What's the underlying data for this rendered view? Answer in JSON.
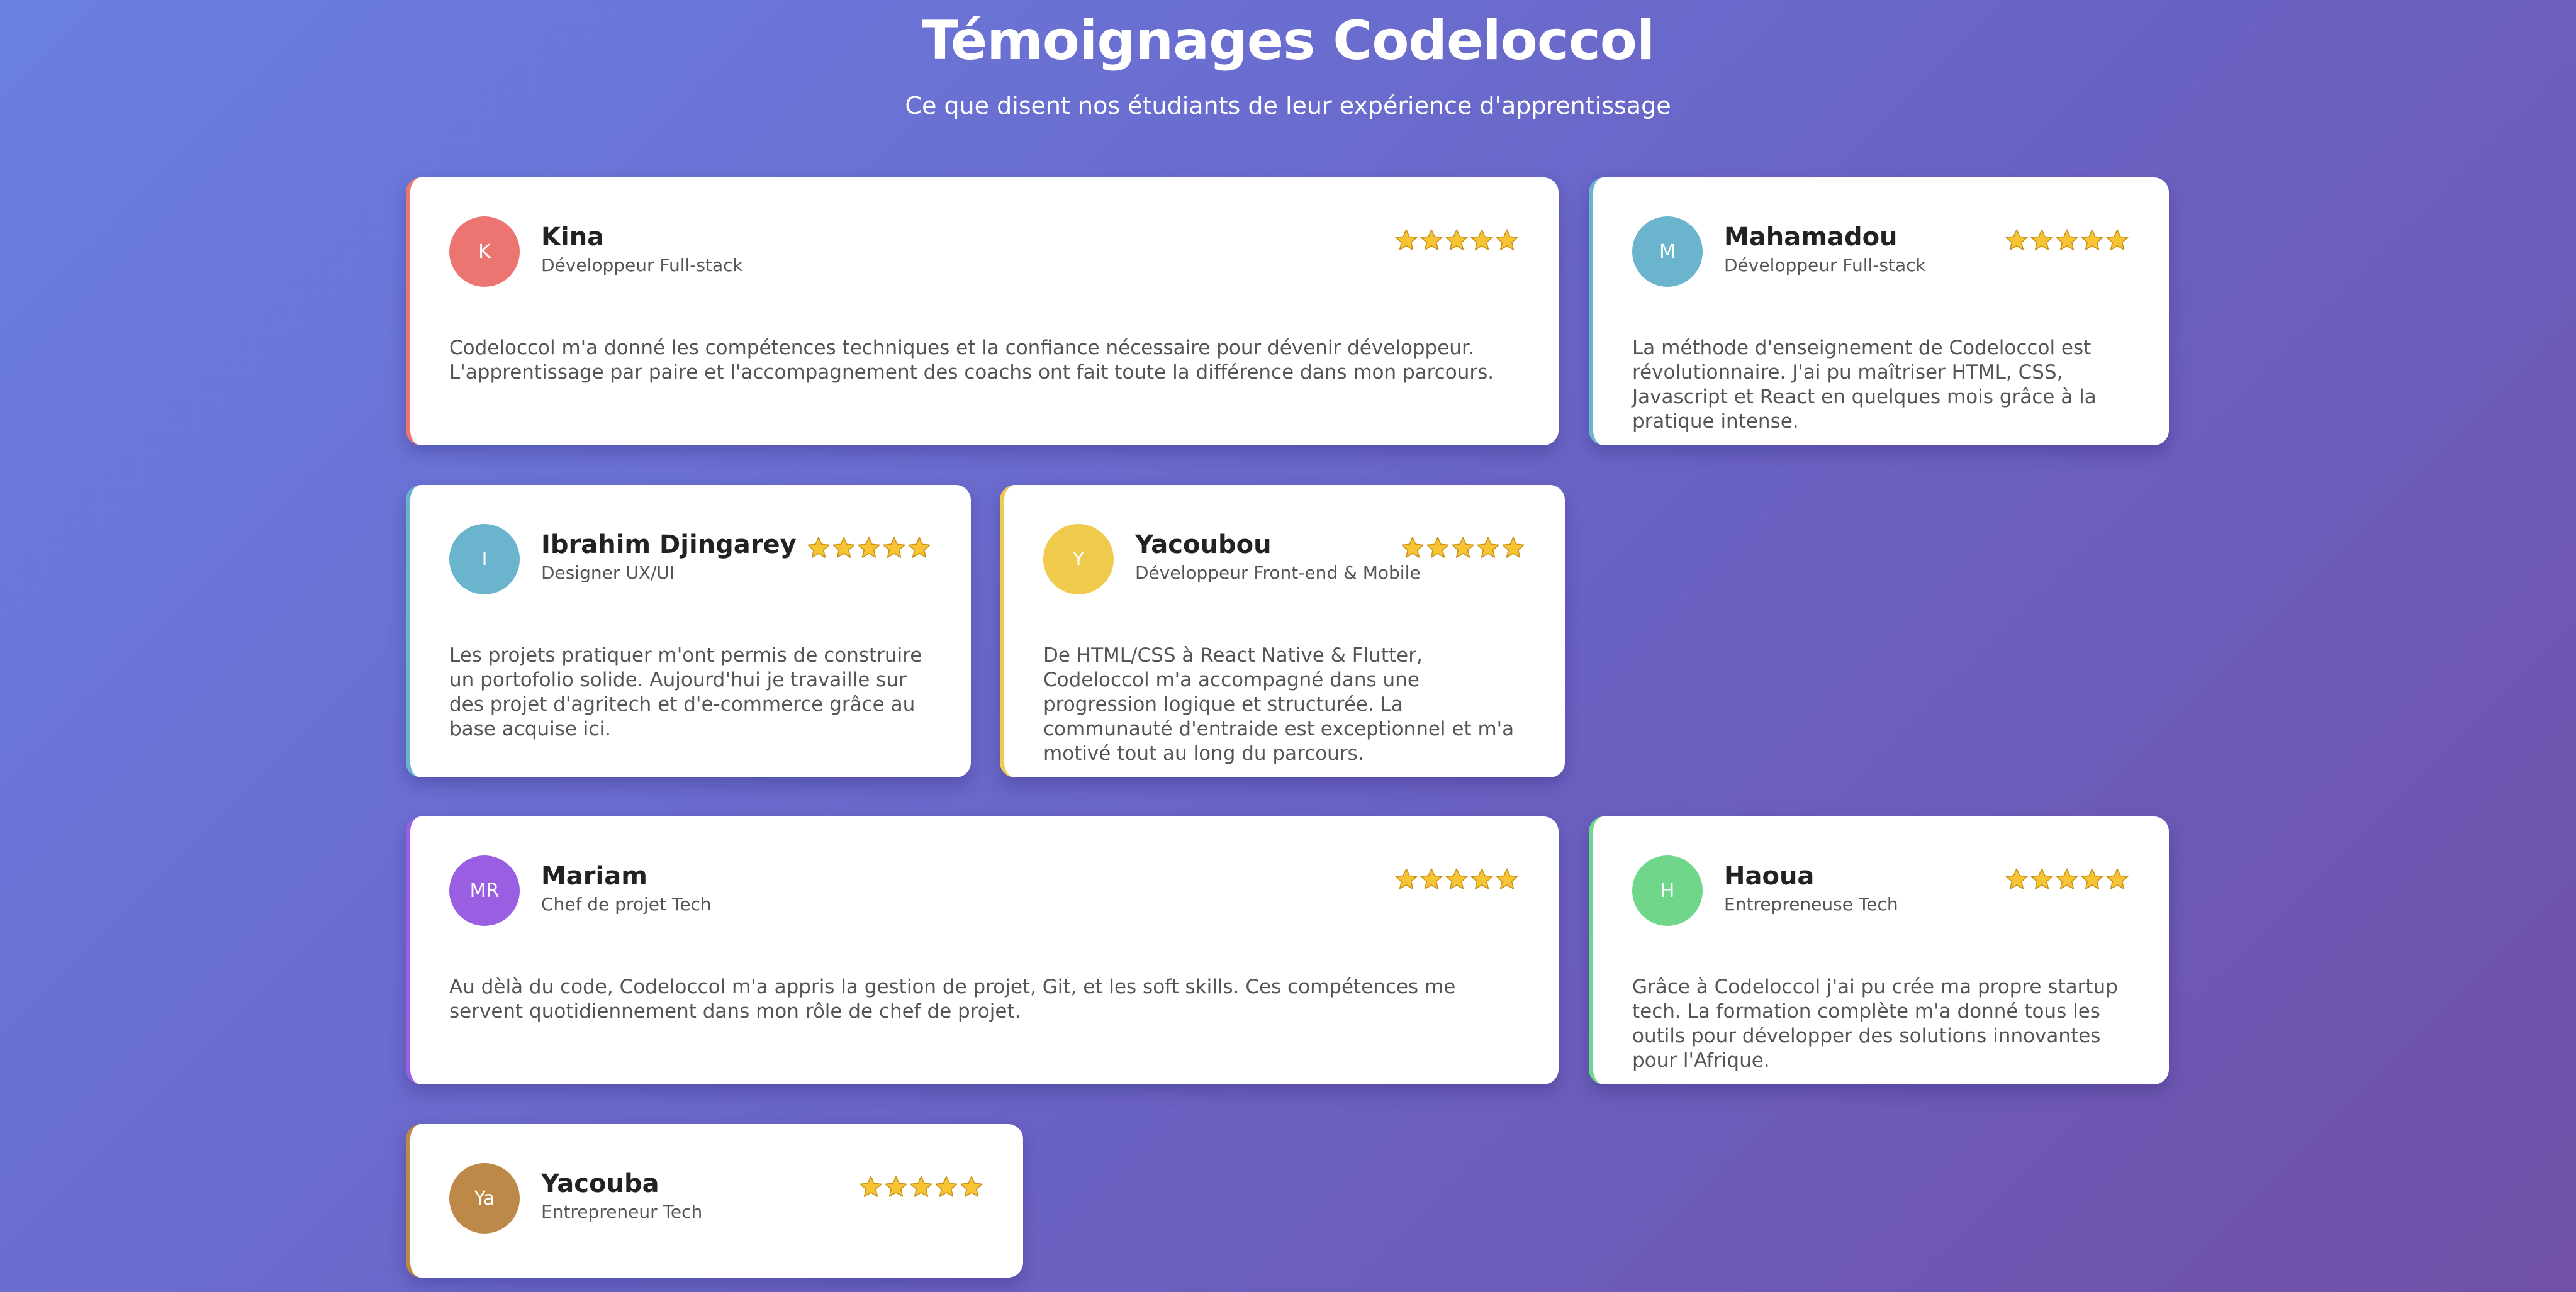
{
  "header": {
    "title": "Témoignages Codeloccol",
    "subtitle": "Ce que disent nos étudiants de leur expérience d'apprentissage"
  },
  "testimonials": [
    {
      "initials": "K",
      "name": "Kina",
      "role": "Développeur Full-stack",
      "stars": 5,
      "text": "Codeloccol m'a donné les compétences techniques et la confiance nécessaire pour dévenir développeur. L'apprentissage par paire et l'accompagnement des coachs ont fait toute la différence dans mon parcours.",
      "color": "#ec7572"
    },
    {
      "initials": "M",
      "name": "Mahamadou",
      "role": "Développeur Full-stack",
      "stars": 5,
      "text": "La méthode d'enseignement de Codeloccol est révolutionnaire. J'ai pu maîtriser HTML, CSS, Javascript et React en quelques mois grâce à la pratique intense.",
      "color": "#6ab4ce"
    },
    {
      "initials": "I",
      "name": "Ibrahim Djingarey",
      "role": "Designer UX/UI",
      "stars": 5,
      "text": "Les projets pratiquer m'ont permis de construire un portofolio solide. Aujourd'hui je travaille sur des projet d'agritech et d'e-commerce grâce au base acquise ici.",
      "color": "#6ab4ce"
    },
    {
      "initials": "Y",
      "name": "Yacoubou",
      "role": "Développeur Front-end & Mobile",
      "stars": 5,
      "text": "De HTML/CSS à React Native & Flutter, Codeloccol m'a accompagné dans une progression logique et structurée. La communauté d'entraide est exceptionnel et m'a motivé tout au long du parcours.",
      "color": "#f0ca4c"
    },
    {
      "initials": "MR",
      "name": "Mariam",
      "role": "Chef de projet Tech",
      "stars": 5,
      "text": "Au dèlà du code, Codeloccol m'a appris la gestion de projet, Git, et les soft skills. Ces compétences me servent quotidiennement dans mon rôle de chef de projet.",
      "color": "#9a5ee2"
    },
    {
      "initials": "H",
      "name": "Haoua",
      "role": "Entrepreneuse Tech",
      "stars": 5,
      "text": "Grâce à Codeloccol j'ai pu crée ma propre startup tech. La formation complète m'a donné tous les outils pour développer des solutions innovantes pour l'Afrique.",
      "color": "#6fd68a"
    },
    {
      "initials": "Ya",
      "name": "Yacouba",
      "role": "Entrepreneur Tech",
      "stars": 5,
      "text": "",
      "color": "#bd8948"
    }
  ]
}
